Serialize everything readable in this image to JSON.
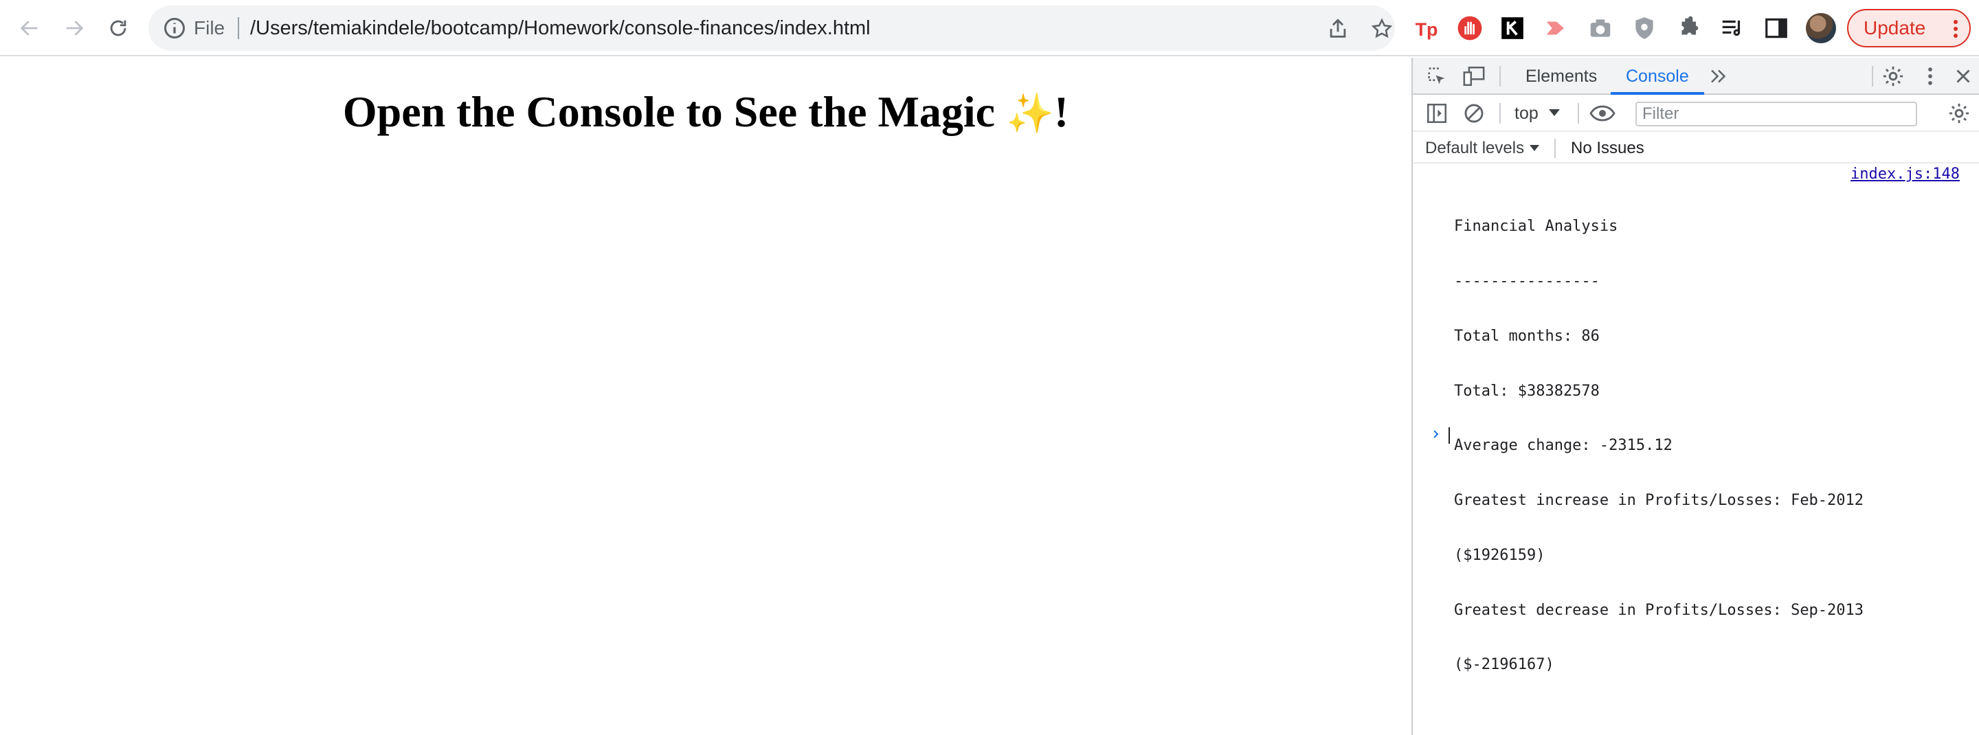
{
  "browser": {
    "omnibox": {
      "scheme_label": "File",
      "url": "/Users/temiakindele/bootcamp/Homework/console-finances/index.html"
    },
    "update_button": {
      "label": "Update"
    },
    "extensions": [
      "tp-extension-icon",
      "hand-stop-extension-icon",
      "k-extension-icon",
      "arrow-extension-icon",
      "camera-extension-icon",
      "shield-extension-icon",
      "puzzle-icon",
      "reading-list-icon",
      "side-panel-icon"
    ]
  },
  "page": {
    "heading": "Open the Console to See the Magic ",
    "heading_sparkles": "✨",
    "heading_end": "!"
  },
  "devtools": {
    "tabs": [
      {
        "label": "Elements",
        "active": false
      },
      {
        "label": "Console",
        "active": true
      }
    ],
    "context": "top",
    "filter_placeholder": "Filter",
    "levels": "Default levels",
    "issues": "No Issues",
    "console": {
      "source": "index.js:148",
      "lines": [
        "Financial Analysis",
        "----------------",
        "Total months: 86",
        "Total: $38382578",
        "Average change: -2315.12",
        "Greatest increase in Profits/Losses: Feb-2012",
        "($1926159)",
        "Greatest decrease in Profits/Losses: Sep-2013",
        "($-2196167)"
      ]
    },
    "colors": {
      "accent": "#1a73e8",
      "link": "#1a0dab"
    }
  }
}
